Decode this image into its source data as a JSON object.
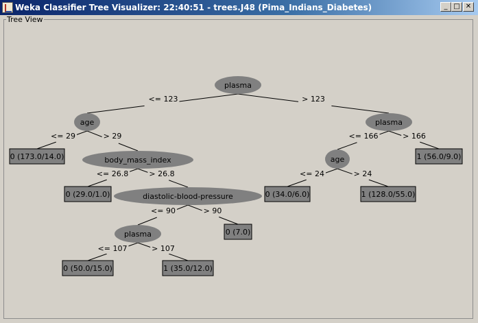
{
  "window": {
    "title": "Weka Classifier Tree Visualizer: 22:40:51 - trees.J48 (Pima_Indians_Diabetes)",
    "minimize": "_",
    "maximize": "□",
    "close": "✕"
  },
  "panel": {
    "label": "Tree View"
  },
  "tree": {
    "nodes": [
      {
        "id": "root",
        "label": "plasma",
        "kind": "split"
      },
      {
        "id": "age1",
        "label": "age",
        "kind": "split"
      },
      {
        "id": "plasma2",
        "label": "plasma",
        "kind": "split"
      },
      {
        "id": "leafA",
        "label": "0 (173.0/14.0)",
        "kind": "leaf"
      },
      {
        "id": "bmi",
        "label": "body_mass_index",
        "kind": "split"
      },
      {
        "id": "age2",
        "label": "age",
        "kind": "split"
      },
      {
        "id": "leafB",
        "label": "1 (56.0/9.0)",
        "kind": "leaf"
      },
      {
        "id": "leafC",
        "label": "0 (29.0/1.0)",
        "kind": "leaf"
      },
      {
        "id": "dbp",
        "label": "diastolic-blood-pressure",
        "kind": "split"
      },
      {
        "id": "leafD",
        "label": "0 (34.0/6.0)",
        "kind": "leaf"
      },
      {
        "id": "leafE",
        "label": "1 (128.0/55.0)",
        "kind": "leaf"
      },
      {
        "id": "plasma3",
        "label": "plasma",
        "kind": "split"
      },
      {
        "id": "leafF",
        "label": "0 (7.0)",
        "kind": "leaf"
      },
      {
        "id": "leafG",
        "label": "0 (50.0/15.0)",
        "kind": "leaf"
      },
      {
        "id": "leafH",
        "label": "1 (35.0/12.0)",
        "kind": "leaf"
      }
    ],
    "edges": [
      {
        "from": "root",
        "to": "age1",
        "label": "<= 123"
      },
      {
        "from": "root",
        "to": "plasma2",
        "label": "> 123"
      },
      {
        "from": "age1",
        "to": "leafA",
        "label": "<= 29"
      },
      {
        "from": "age1",
        "to": "bmi",
        "label": "> 29"
      },
      {
        "from": "plasma2",
        "to": "age2",
        "label": "<= 166"
      },
      {
        "from": "plasma2",
        "to": "leafB",
        "label": "> 166"
      },
      {
        "from": "bmi",
        "to": "leafC",
        "label": "<= 26.8"
      },
      {
        "from": "bmi",
        "to": "dbp",
        "label": "> 26.8"
      },
      {
        "from": "age2",
        "to": "leafD",
        "label": "<= 24"
      },
      {
        "from": "age2",
        "to": "leafE",
        "label": "> 24"
      },
      {
        "from": "dbp",
        "to": "plasma3",
        "label": "<= 90"
      },
      {
        "from": "dbp",
        "to": "leafF",
        "label": "> 90"
      },
      {
        "from": "plasma3",
        "to": "leafG",
        "label": "<= 107"
      },
      {
        "from": "plasma3",
        "to": "leafH",
        "label": "> 107"
      }
    ]
  },
  "colors": {
    "node_fill": "#808080",
    "edge": "#000000",
    "background": "#d4d0c8"
  }
}
